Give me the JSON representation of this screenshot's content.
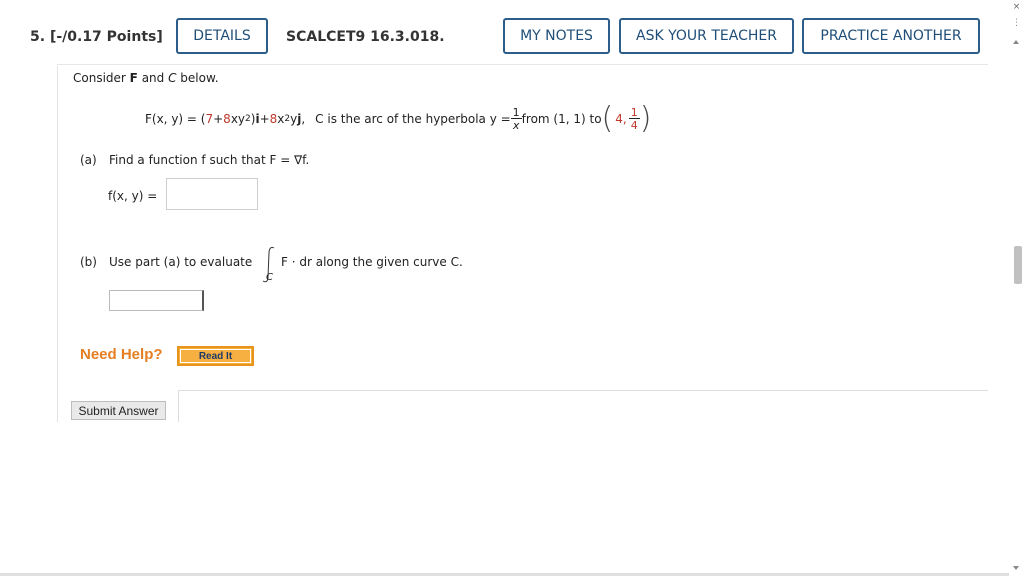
{
  "header": {
    "number": "5.",
    "points": "[-/0.17 Points]",
    "details_label": "DETAILS",
    "assignment_code": "SCALCET9 16.3.018.",
    "my_notes_label": "MY NOTES",
    "ask_teacher_label": "ASK YOUR TEACHER",
    "practice_label": "PRACTICE ANOTHER"
  },
  "problem": {
    "intro_pre": "Consider ",
    "intro_F": "F",
    "intro_and": " and ",
    "intro_C": "C",
    "intro_post": " below.",
    "field_lhs": "F(x, y) = (",
    "field_c1": "7",
    "field_plus1": " + ",
    "field_c2": "8",
    "field_t2": "xy",
    "field_exp2": "2",
    "field_close": ")",
    "field_i": "i",
    "field_plus2": " + ",
    "field_c3": "8",
    "field_t3": "x",
    "field_exp3": "2",
    "field_t3b": "y",
    "field_j": "j",
    "field_comma": ",",
    "curve_text": "C is the arc of the hyperbola y = ",
    "frac_num": "1",
    "frac_den": "x",
    "from_text": " from (1, 1) to ",
    "point_x": "4,",
    "point_num": "1",
    "point_den": "4"
  },
  "part_a": {
    "label": "(a)",
    "prompt": "Find a function f such that F = ∇f.",
    "answer_label": "f(x, y) =",
    "answer_value": ""
  },
  "part_b": {
    "label": "(b)",
    "prompt": "Use part (a) to evaluate",
    "integral_sub": "C",
    "integrand": "F · dr along the given curve C.",
    "answer_value": ""
  },
  "help": {
    "label": "Need Help?",
    "read_it_label": "Read It"
  },
  "submit_label": "Submit Answer",
  "scrollbar": {
    "close_glyph": "×",
    "menu_glyph": "⋮"
  }
}
